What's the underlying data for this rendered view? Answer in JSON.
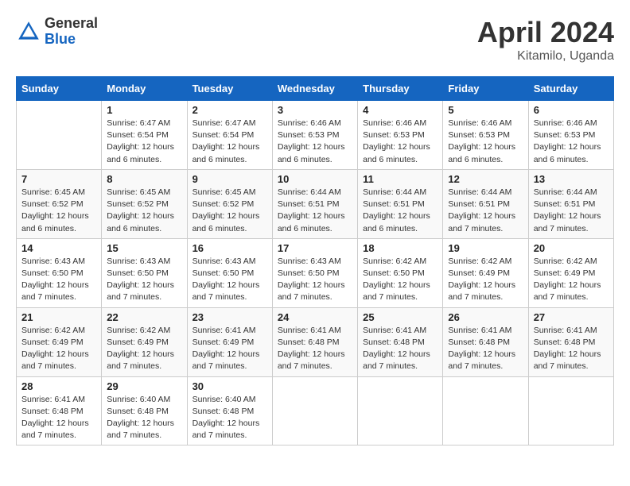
{
  "header": {
    "logo_general": "General",
    "logo_blue": "Blue",
    "month_title": "April 2024",
    "location": "Kitamilo, Uganda"
  },
  "days_of_week": [
    "Sunday",
    "Monday",
    "Tuesday",
    "Wednesday",
    "Thursday",
    "Friday",
    "Saturday"
  ],
  "weeks": [
    [
      {
        "day": "",
        "info": ""
      },
      {
        "day": "1",
        "info": "Sunrise: 6:47 AM\nSunset: 6:54 PM\nDaylight: 12 hours\nand 6 minutes."
      },
      {
        "day": "2",
        "info": "Sunrise: 6:47 AM\nSunset: 6:54 PM\nDaylight: 12 hours\nand 6 minutes."
      },
      {
        "day": "3",
        "info": "Sunrise: 6:46 AM\nSunset: 6:53 PM\nDaylight: 12 hours\nand 6 minutes."
      },
      {
        "day": "4",
        "info": "Sunrise: 6:46 AM\nSunset: 6:53 PM\nDaylight: 12 hours\nand 6 minutes."
      },
      {
        "day": "5",
        "info": "Sunrise: 6:46 AM\nSunset: 6:53 PM\nDaylight: 12 hours\nand 6 minutes."
      },
      {
        "day": "6",
        "info": "Sunrise: 6:46 AM\nSunset: 6:53 PM\nDaylight: 12 hours\nand 6 minutes."
      }
    ],
    [
      {
        "day": "7",
        "info": "Sunrise: 6:45 AM\nSunset: 6:52 PM\nDaylight: 12 hours\nand 6 minutes."
      },
      {
        "day": "8",
        "info": "Sunrise: 6:45 AM\nSunset: 6:52 PM\nDaylight: 12 hours\nand 6 minutes."
      },
      {
        "day": "9",
        "info": "Sunrise: 6:45 AM\nSunset: 6:52 PM\nDaylight: 12 hours\nand 6 minutes."
      },
      {
        "day": "10",
        "info": "Sunrise: 6:44 AM\nSunset: 6:51 PM\nDaylight: 12 hours\nand 6 minutes."
      },
      {
        "day": "11",
        "info": "Sunrise: 6:44 AM\nSunset: 6:51 PM\nDaylight: 12 hours\nand 6 minutes."
      },
      {
        "day": "12",
        "info": "Sunrise: 6:44 AM\nSunset: 6:51 PM\nDaylight: 12 hours\nand 7 minutes."
      },
      {
        "day": "13",
        "info": "Sunrise: 6:44 AM\nSunset: 6:51 PM\nDaylight: 12 hours\nand 7 minutes."
      }
    ],
    [
      {
        "day": "14",
        "info": "Sunrise: 6:43 AM\nSunset: 6:50 PM\nDaylight: 12 hours\nand 7 minutes."
      },
      {
        "day": "15",
        "info": "Sunrise: 6:43 AM\nSunset: 6:50 PM\nDaylight: 12 hours\nand 7 minutes."
      },
      {
        "day": "16",
        "info": "Sunrise: 6:43 AM\nSunset: 6:50 PM\nDaylight: 12 hours\nand 7 minutes."
      },
      {
        "day": "17",
        "info": "Sunrise: 6:43 AM\nSunset: 6:50 PM\nDaylight: 12 hours\nand 7 minutes."
      },
      {
        "day": "18",
        "info": "Sunrise: 6:42 AM\nSunset: 6:50 PM\nDaylight: 12 hours\nand 7 minutes."
      },
      {
        "day": "19",
        "info": "Sunrise: 6:42 AM\nSunset: 6:49 PM\nDaylight: 12 hours\nand 7 minutes."
      },
      {
        "day": "20",
        "info": "Sunrise: 6:42 AM\nSunset: 6:49 PM\nDaylight: 12 hours\nand 7 minutes."
      }
    ],
    [
      {
        "day": "21",
        "info": "Sunrise: 6:42 AM\nSunset: 6:49 PM\nDaylight: 12 hours\nand 7 minutes."
      },
      {
        "day": "22",
        "info": "Sunrise: 6:42 AM\nSunset: 6:49 PM\nDaylight: 12 hours\nand 7 minutes."
      },
      {
        "day": "23",
        "info": "Sunrise: 6:41 AM\nSunset: 6:49 PM\nDaylight: 12 hours\nand 7 minutes."
      },
      {
        "day": "24",
        "info": "Sunrise: 6:41 AM\nSunset: 6:48 PM\nDaylight: 12 hours\nand 7 minutes."
      },
      {
        "day": "25",
        "info": "Sunrise: 6:41 AM\nSunset: 6:48 PM\nDaylight: 12 hours\nand 7 minutes."
      },
      {
        "day": "26",
        "info": "Sunrise: 6:41 AM\nSunset: 6:48 PM\nDaylight: 12 hours\nand 7 minutes."
      },
      {
        "day": "27",
        "info": "Sunrise: 6:41 AM\nSunset: 6:48 PM\nDaylight: 12 hours\nand 7 minutes."
      }
    ],
    [
      {
        "day": "28",
        "info": "Sunrise: 6:41 AM\nSunset: 6:48 PM\nDaylight: 12 hours\nand 7 minutes."
      },
      {
        "day": "29",
        "info": "Sunrise: 6:40 AM\nSunset: 6:48 PM\nDaylight: 12 hours\nand 7 minutes."
      },
      {
        "day": "30",
        "info": "Sunrise: 6:40 AM\nSunset: 6:48 PM\nDaylight: 12 hours\nand 7 minutes."
      },
      {
        "day": "",
        "info": ""
      },
      {
        "day": "",
        "info": ""
      },
      {
        "day": "",
        "info": ""
      },
      {
        "day": "",
        "info": ""
      }
    ]
  ]
}
